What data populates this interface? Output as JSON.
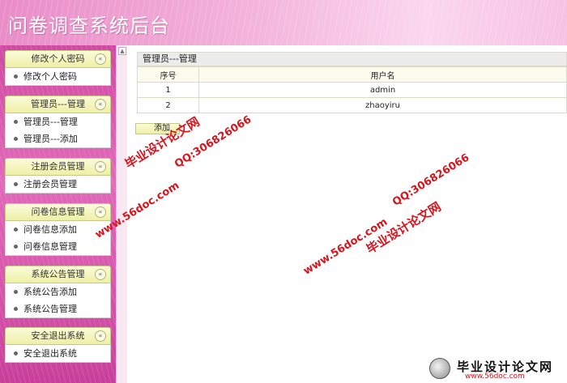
{
  "header": {
    "title": "问卷调查系统后台"
  },
  "sidebar": {
    "groups": [
      {
        "title": "修改个人密码",
        "items": [
          "修改个人密码"
        ]
      },
      {
        "title": "管理员---管理",
        "items": [
          "管理员---管理",
          "管理员---添加"
        ]
      },
      {
        "title": "注册会员管理",
        "items": [
          "注册会员管理"
        ]
      },
      {
        "title": "问卷信息管理",
        "items": [
          "问卷信息添加",
          "问卷信息管理"
        ]
      },
      {
        "title": "系统公告管理",
        "items": [
          "系统公告添加",
          "系统公告管理"
        ]
      },
      {
        "title": "安全退出系统",
        "items": [
          "安全退出系统"
        ]
      }
    ],
    "collapse_glyph": "«"
  },
  "main": {
    "panel_title": "管理员---管理",
    "table": {
      "headers": [
        "序号",
        "用户名"
      ],
      "rows": [
        [
          "1",
          "admin"
        ],
        [
          "2",
          "zhaoyiru"
        ]
      ]
    },
    "add_button": "添加"
  },
  "watermarks": {
    "site_cn": "毕业设计论文网",
    "url": "www.56doc.com",
    "qq": "QQ:306826066"
  },
  "logo": {
    "text": "毕业设计论文网",
    "url": "www.56doc.com"
  },
  "colors": {
    "header_pink": "#f3b4dc",
    "sidebar_pink": "#e16ab9",
    "menu_head_yellow": "#eef0a6",
    "watermark_red": "#d8141c"
  }
}
